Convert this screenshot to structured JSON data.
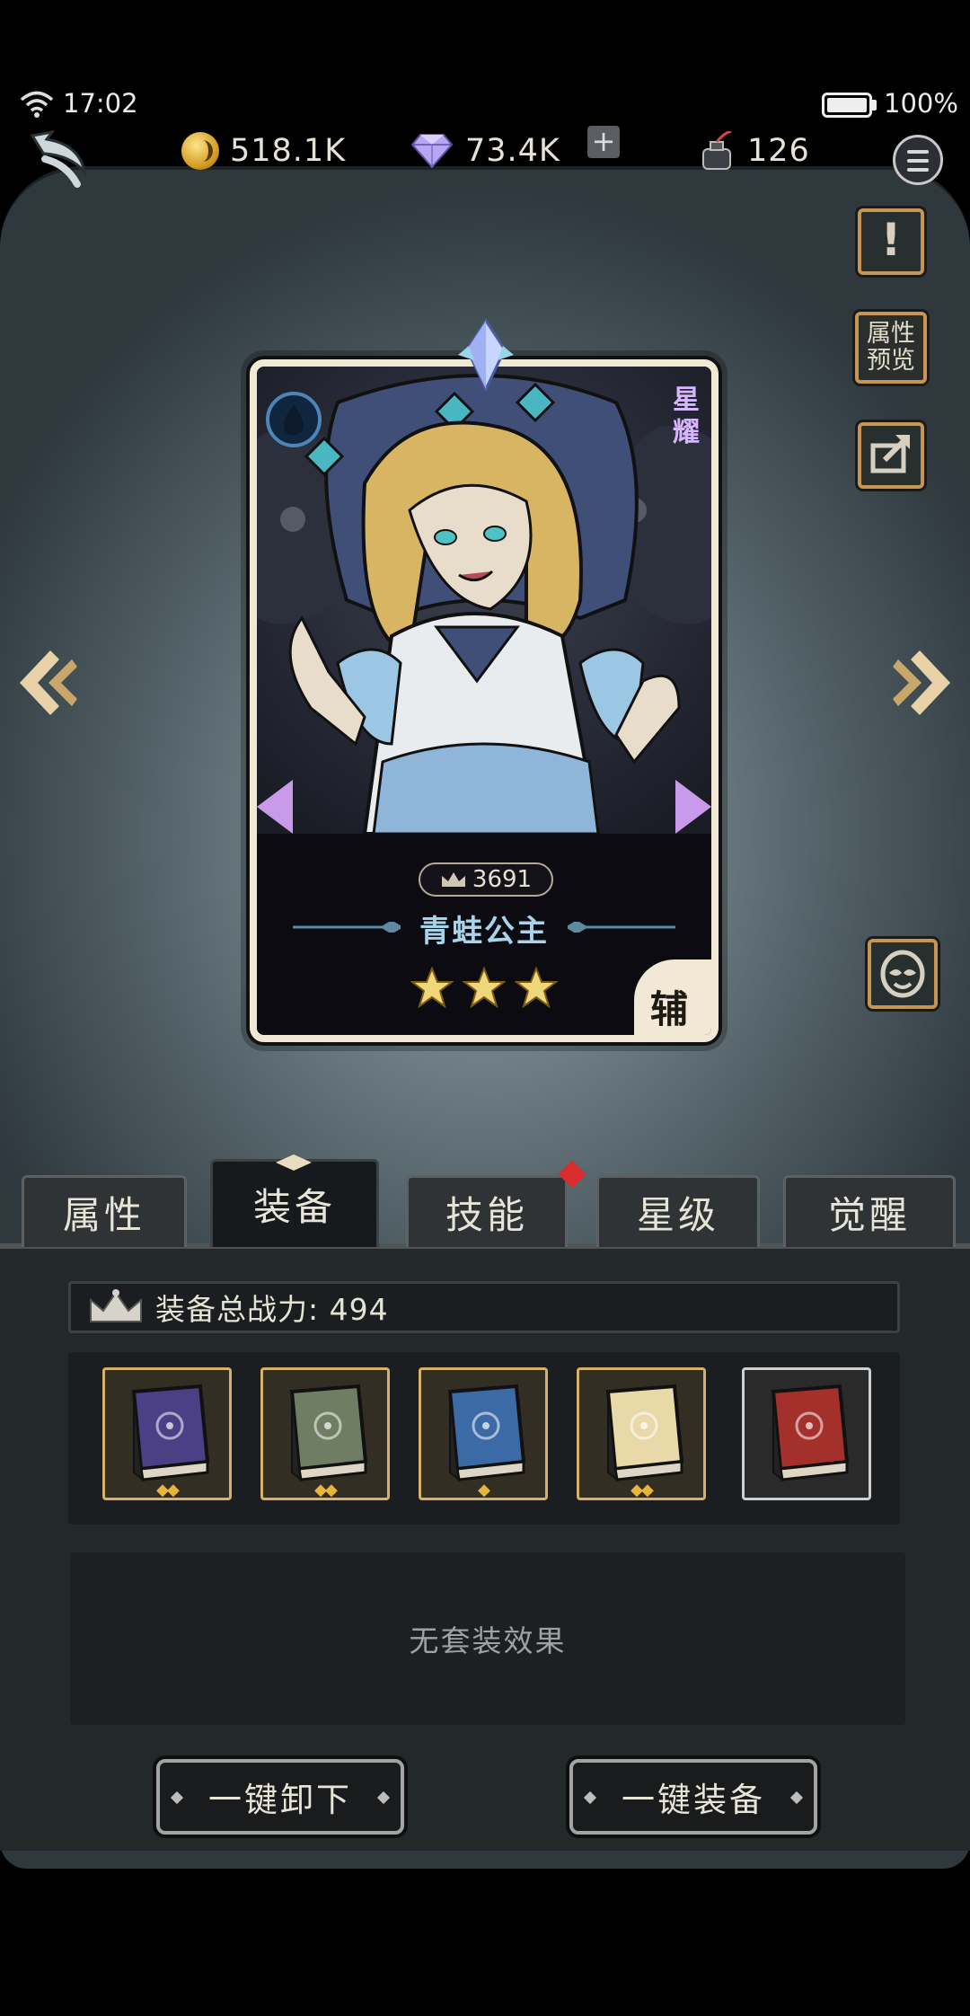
{
  "status_bar": {
    "time": "17:02",
    "battery": "100%"
  },
  "resources": {
    "coins": "518.1K",
    "gems": "73.4K",
    "ink": "126",
    "add_symbol": "+"
  },
  "side_buttons": {
    "preview_line1": "属性",
    "preview_line2": "预览"
  },
  "hero": {
    "power": "3691",
    "name": "青蛙公主",
    "stars": 3,
    "rank_line1": "星",
    "rank_line2": "耀",
    "role": "辅",
    "element": "water-drop-icon"
  },
  "tabs": [
    {
      "label": "属性",
      "active": false
    },
    {
      "label": "装备",
      "active": true
    },
    {
      "label": "技能",
      "active": false,
      "notify": true
    },
    {
      "label": "星级",
      "active": false
    },
    {
      "label": "觉醒",
      "active": false
    }
  ],
  "equipment": {
    "total_power_label": "装备总战力: 494",
    "slots": [
      {
        "book_color": "#4b3f86",
        "stars": 2,
        "frame": "gold"
      },
      {
        "book_color": "#6f7d62",
        "stars": 2,
        "frame": "gold"
      },
      {
        "book_color": "#3c6aa6",
        "stars": 1,
        "frame": "gold"
      },
      {
        "book_color": "#e9d9a8",
        "stars": 2,
        "frame": "gold"
      },
      {
        "book_color": "#a4302c",
        "stars": 0,
        "frame": "silver"
      }
    ],
    "set_effect": "无套装效果"
  },
  "actions": {
    "unequip_all": "一键卸下",
    "equip_all": "一键装备"
  },
  "colors": {
    "accent_gold": "#c79552",
    "hero_name": "#a9d3e8",
    "panel": "#232829"
  }
}
